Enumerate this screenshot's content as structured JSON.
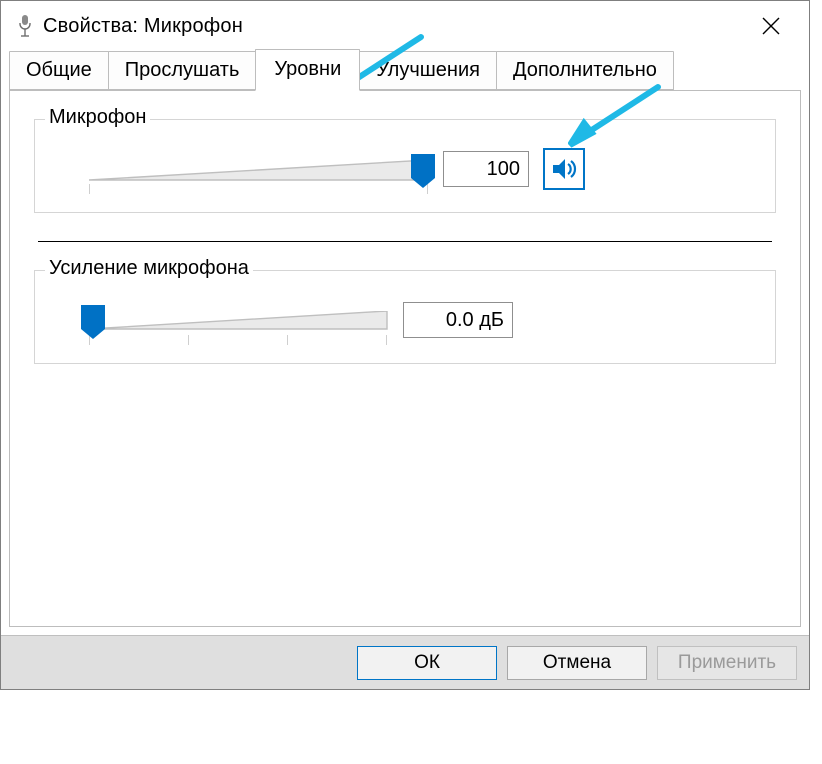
{
  "window": {
    "title": "Свойства: Микрофон"
  },
  "tabs": [
    {
      "label": "Общие"
    },
    {
      "label": "Прослушать"
    },
    {
      "label": "Уровни"
    },
    {
      "label": "Улучшения"
    },
    {
      "label": "Дополнительно"
    }
  ],
  "active_tab_index": 2,
  "groups": {
    "microphone": {
      "label": "Микрофон",
      "value": "100",
      "slider_percent": 100,
      "show_mute": true
    },
    "boost": {
      "label": "Усиление микрофона",
      "value": "0.0 дБ",
      "slider_percent": 0,
      "show_mute": false
    }
  },
  "buttons": {
    "ok": "ОК",
    "cancel": "Отмена",
    "apply": "Применить"
  }
}
